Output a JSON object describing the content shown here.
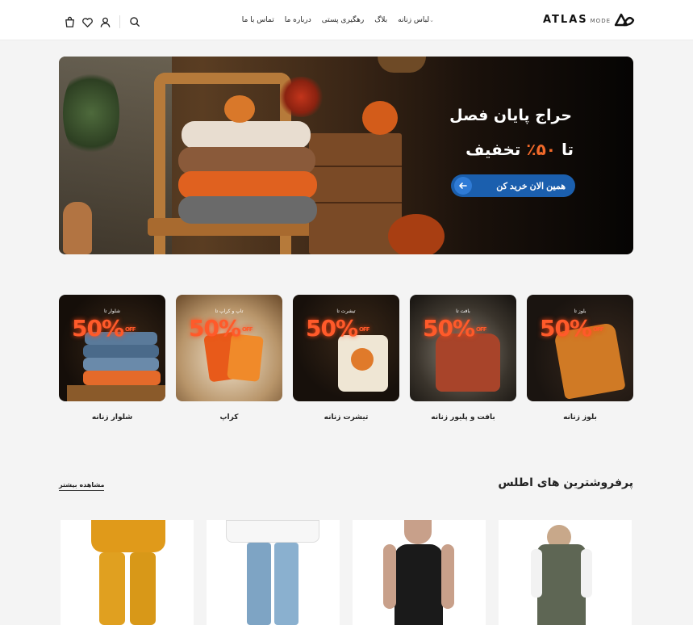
{
  "header": {
    "brand": "ATLAS",
    "brand_sub": "MODE",
    "nav": [
      {
        "label": "لباس زنانه",
        "dropdown": true
      },
      {
        "label": "بلاگ"
      },
      {
        "label": "رهگیری پستی"
      },
      {
        "label": "درباره ما"
      },
      {
        "label": "تماس با ما"
      }
    ],
    "icons": [
      "cart-icon",
      "heart-icon",
      "user-icon",
      "search-icon"
    ]
  },
  "hero": {
    "title_line1": "حراج پایان فصل",
    "title_line2_prefix": "تا",
    "title_line2_percent": "۵۰٪",
    "title_line2_suffix": "تخفیف",
    "cta_label": "همین الان خرید کن"
  },
  "categories": [
    {
      "label": "بلوز زنانه",
      "badge_small": "بلوز تا",
      "badge_big": "50%",
      "badge_off": "OFF"
    },
    {
      "label": "بافت و پلیور زنانه",
      "badge_small": "بافت تا",
      "badge_big": "50%",
      "badge_off": "OFF"
    },
    {
      "label": "تیشرت زنانه",
      "badge_small": "تیشرت تا",
      "badge_big": "50%",
      "badge_off": "OFF"
    },
    {
      "label": "کراپ",
      "badge_small": "تاپ و کراپ تا",
      "badge_big": "50%",
      "badge_off": "OFF"
    },
    {
      "label": "شلوار زنانه",
      "badge_small": "شلوار تا",
      "badge_big": "50%",
      "badge_off": "OFF"
    }
  ],
  "bestsellers": {
    "title": "پرفروشترین های اطلس",
    "more_link": "مشاهده بیشتر"
  },
  "colors": {
    "accent_blue": "#1b5fae",
    "sale_orange": "#ff5a2a"
  }
}
